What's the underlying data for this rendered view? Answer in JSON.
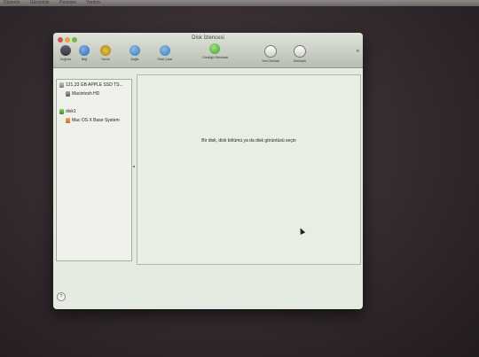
{
  "menubar": {
    "items": [
      "Düzenle",
      "Görüntüle",
      "Pencere",
      "Yardım"
    ]
  },
  "window": {
    "title": "Disk İzlencesi"
  },
  "toolbar": {
    "items": [
      {
        "label": "Doğrula",
        "icon": "microscope-icon"
      },
      {
        "label": "Bilgi",
        "icon": "info-icon"
      },
      {
        "label": "Yazdır",
        "icon": "burn-icon"
      },
      {
        "label": "Bağla",
        "icon": "mount-icon"
      },
      {
        "label": "Diski Çıkar",
        "icon": "eject-icon"
      },
      {
        "label": "Günlüğü Etkinleştir",
        "icon": "journaling-icon"
      },
      {
        "label": "Yeni Görüntü",
        "icon": "new-image-icon"
      },
      {
        "label": "Dönüştür",
        "icon": "convert-icon"
      }
    ],
    "overflow": "»"
  },
  "sidebar": {
    "items": [
      {
        "label": "121,33 GB APPLE SSD TS...",
        "type": "disk"
      },
      {
        "label": "Macintosh HD",
        "type": "volume"
      },
      {
        "label": "disk1",
        "type": "image"
      },
      {
        "label": "Mac OS X Base System",
        "type": "volume"
      }
    ]
  },
  "main": {
    "prompt": "Bir disk, disk bölümü ya da disk görüntüsü seçin"
  },
  "help": {
    "label": "?"
  }
}
